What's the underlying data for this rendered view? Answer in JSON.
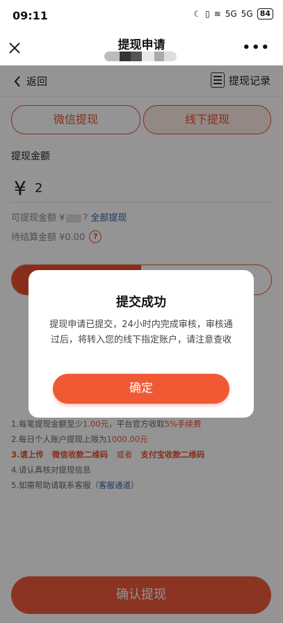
{
  "status_bar": {
    "time": "09:11",
    "battery": "84",
    "signal_1": "5G",
    "signal_2": "5G"
  },
  "header": {
    "title": "提现申请",
    "more_label": "•••"
  },
  "nav": {
    "back_label": "返回",
    "records_label": "提现记录"
  },
  "methods": [
    {
      "label": "微信提现"
    },
    {
      "label": "线下提现"
    }
  ],
  "amount": {
    "label": "提现金额",
    "currency": "¥",
    "value": "2"
  },
  "available": {
    "label": "可提现金额 ¥",
    "suffix": "?",
    "all_label": "全部提现"
  },
  "pending": {
    "label": "待结算金额 ¥0.00",
    "help": "?"
  },
  "notes": {
    "n1_a": "1.每笔提现金额至少",
    "n1_b": "1.00元",
    "n1_c": "，平台官方收取",
    "n1_d": "5%手续费",
    "n2_a": "2.每日个人账户提现上限为",
    "n2_b": "1000.00元",
    "n3_a": "3.请上传",
    "n3_b": "微信收款二维码",
    "n3_c": "或者",
    "n3_d": "支付宝收款二维码",
    "n4": "4.请认真核对提现信息",
    "n5_a": "5.如需帮助请联系客服（",
    "n5_b": "客服通道",
    "n5_c": "）"
  },
  "submit_label": "确认提现",
  "modal": {
    "title": "提交成功",
    "message": "提现申请已提交，24小时内完成审核，审核通过后，将转入您的线下指定账户，请注意查收",
    "confirm_label": "确定"
  },
  "colors": {
    "accent": "#e8502f",
    "link": "#2f5fa8",
    "overlay": "rgba(0,0,0,0.42)"
  }
}
